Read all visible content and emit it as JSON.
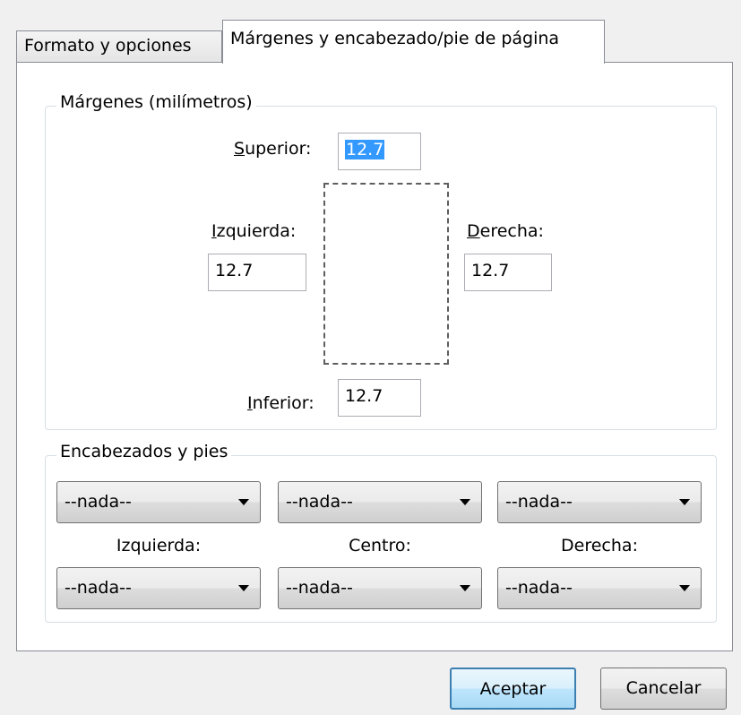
{
  "tabs": [
    {
      "label": "Formato y opciones",
      "active": false
    },
    {
      "label": "Márgenes y encabezado/pie de página",
      "active": true
    }
  ],
  "margins": {
    "legend": "Márgenes (milímetros)",
    "top": {
      "label_underline": "S",
      "label_rest": "uperior:",
      "value": "12.7",
      "selected": true
    },
    "left": {
      "label_underline": "I",
      "label_rest": "zquierda:",
      "value": "12.7"
    },
    "right": {
      "label_underline": "D",
      "label_rest": "erecha:",
      "value": "12.7"
    },
    "bottom": {
      "label_underline": "I",
      "label_rest": "nferior:",
      "value": "12.7"
    }
  },
  "headers_footers": {
    "legend": "Encabezados y pies",
    "header_row": [
      "--nada--",
      "--nada--",
      "--nada--"
    ],
    "column_labels": [
      "Izquierda:",
      "Centro:",
      "Derecha:"
    ],
    "footer_row": [
      "--nada--",
      "--nada--",
      "--nada--"
    ]
  },
  "buttons": {
    "ok": "Aceptar",
    "cancel": "Cancelar"
  },
  "colors": {
    "selection": "#3399ff",
    "default_button_border": "#3c7fb1"
  }
}
